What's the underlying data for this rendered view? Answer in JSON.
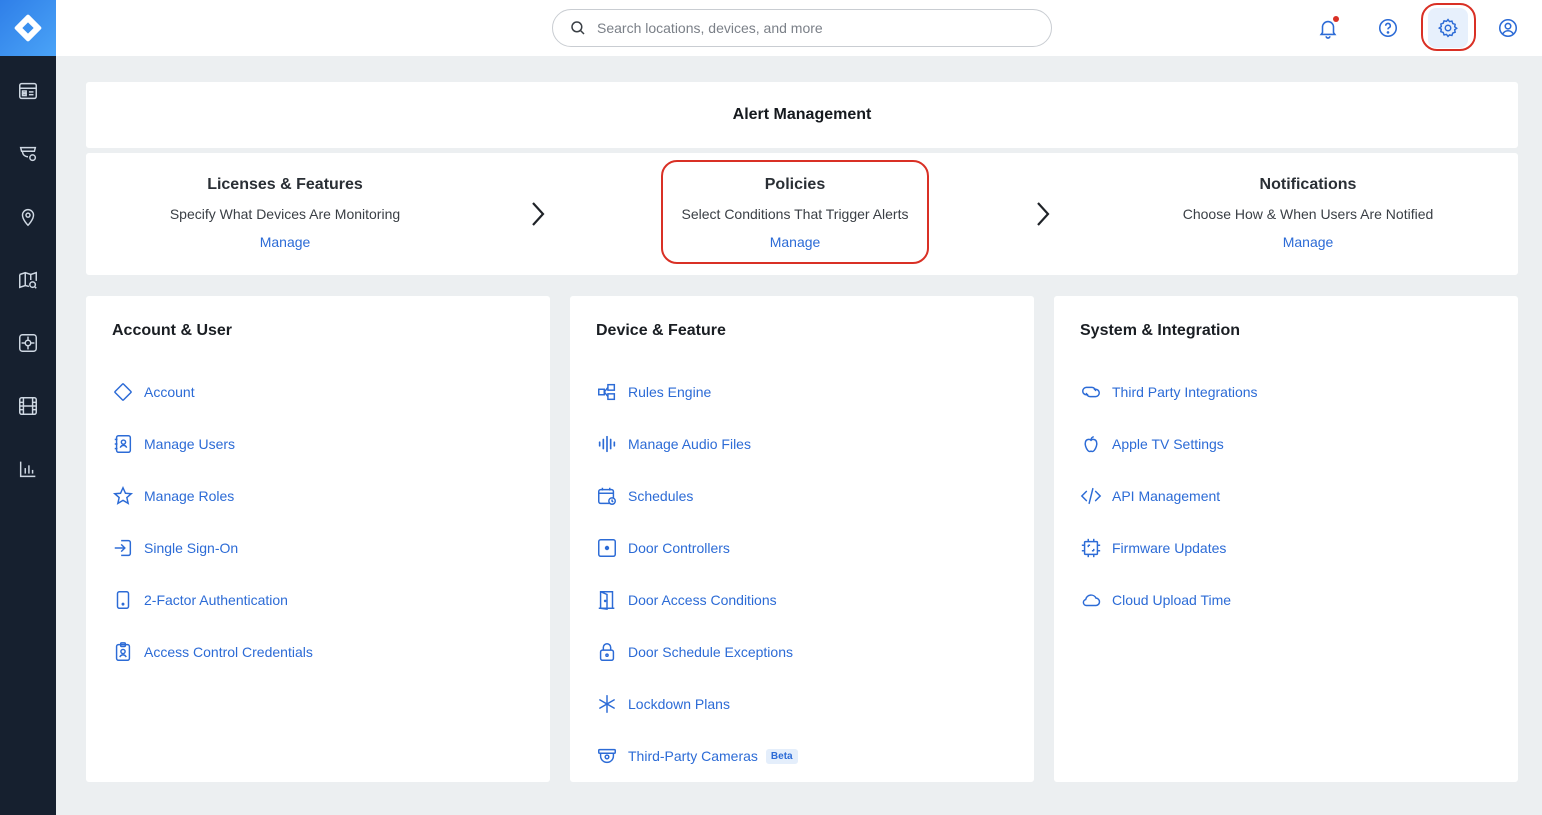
{
  "search": {
    "placeholder": "Search locations, devices, and more"
  },
  "alert_management": {
    "title": "Alert Management",
    "steps": [
      {
        "title": "Licenses & Features",
        "description": "Specify What Devices Are Monitoring",
        "link": "Manage"
      },
      {
        "title": "Policies",
        "description": "Select Conditions That Trigger Alerts",
        "link": "Manage"
      },
      {
        "title": "Notifications",
        "description": "Choose How & When Users Are Notified",
        "link": "Manage"
      }
    ]
  },
  "cards": [
    {
      "title": "Account & User",
      "items": [
        {
          "label": "Account",
          "icon": "diamond-icon"
        },
        {
          "label": "Manage Users",
          "icon": "users-icon"
        },
        {
          "label": "Manage Roles",
          "icon": "star-icon"
        },
        {
          "label": "Single Sign-On",
          "icon": "sign-in-icon"
        },
        {
          "label": "2-Factor Authentication",
          "icon": "phone-icon"
        },
        {
          "label": "Access Control Credentials",
          "icon": "badge-icon"
        }
      ]
    },
    {
      "title": "Device & Feature",
      "items": [
        {
          "label": "Rules Engine",
          "icon": "rules-icon"
        },
        {
          "label": "Manage Audio Files",
          "icon": "audio-icon"
        },
        {
          "label": "Schedules",
          "icon": "calendar-icon"
        },
        {
          "label": "Door Controllers",
          "icon": "door-controller-icon"
        },
        {
          "label": "Door Access Conditions",
          "icon": "door-icon"
        },
        {
          "label": "Door Schedule Exceptions",
          "icon": "lock-icon"
        },
        {
          "label": "Lockdown Plans",
          "icon": "asterisk-icon"
        },
        {
          "label": "Third-Party Cameras",
          "icon": "camera-icon",
          "badge": "Beta"
        }
      ]
    },
    {
      "title": "System & Integration",
      "items": [
        {
          "label": "Third Party Integrations",
          "icon": "link-icon"
        },
        {
          "label": "Apple TV Settings",
          "icon": "apple-icon"
        },
        {
          "label": "API Management",
          "icon": "code-icon"
        },
        {
          "label": "Firmware Updates",
          "icon": "chip-icon"
        },
        {
          "label": "Cloud Upload Time",
          "icon": "cloud-icon"
        }
      ]
    }
  ],
  "colors": {
    "accent": "#2c6bd6",
    "rail": "#16202f",
    "highlight": "#d93025"
  }
}
